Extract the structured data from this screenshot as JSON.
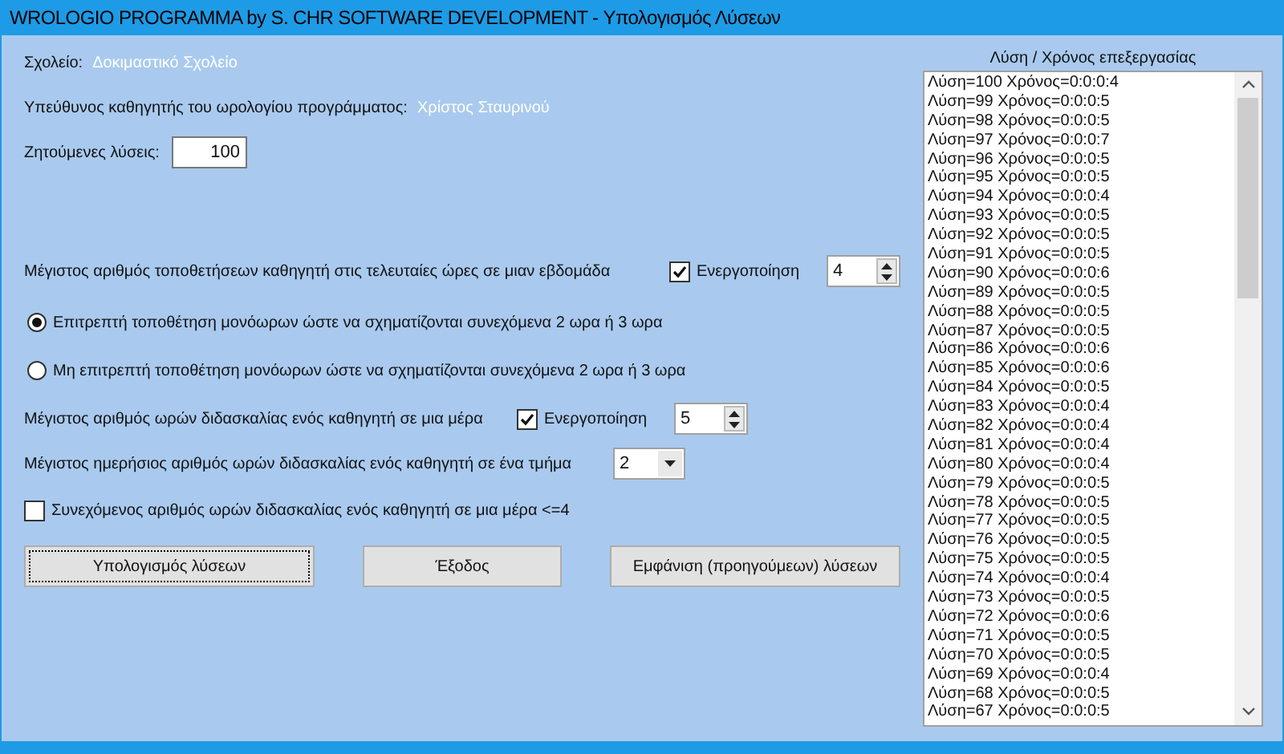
{
  "window": {
    "title": "WROLOGIO PROGRAMMA by S. CHR SOFTWARE DEVELOPMENT - Υπολογισμός Λύσεων"
  },
  "info": [
    {
      "label": "Σχολείο:",
      "value": "Δοκιμαστικό Σχολείο"
    },
    {
      "label": "Υπεύθυνος καθηγητής του ωρολογίου προγράμματος:",
      "value": "Χρίστος Σταυρινού"
    }
  ],
  "requested": {
    "label": "Ζητούμενες λύσεις:",
    "value": "100"
  },
  "options": [
    {
      "kind": "limit",
      "label": "Μέγιστος αριθμός τοποθετήσεων καθηγητή στις τελευταίες ώρες σε μιαν εβδομάδα",
      "check_label": "Ενεργοποίηση",
      "checked": true,
      "value": "4"
    },
    {
      "kind": "radio",
      "label": "Επιτρεπτή τοποθέτηση μονόωρων ώστε να σχηματίζονται συνεχόμενα 2 ωρα ή 3 ωρα",
      "selected": true
    },
    {
      "kind": "radio",
      "label": "Μη επιτρεπτή τοποθέτηση μονόωρων ώστε να σχηματίζονται συνεχόμενα 2 ωρα ή 3 ωρα",
      "selected": false
    },
    {
      "kind": "limit",
      "label": "Μέγιστος αριθμός ωρών διδασκαλίας ενός καθηγητή σε μια μέρα",
      "check_label": "Ενεργοποίηση",
      "checked": true,
      "value": "5"
    },
    {
      "kind": "combo",
      "label": "Μέγιστος ημερήσιος αριθμός ωρών διδασκαλίας ενός καθηγητή σε ένα τμήμα",
      "value": "2"
    },
    {
      "kind": "check",
      "label": "Συνεχόμενος αριθμός ωρών διδασκαλίας ενός καθηγητή σε μια μέρα <=4",
      "checked": false
    }
  ],
  "buttons": [
    {
      "label": "Υπολογισμός λύσεων",
      "focused": true
    },
    {
      "label": "Έξοδος",
      "focused": false
    },
    {
      "label": "Εμφάνιση (προηγούμεων) λύσεων",
      "focused": false
    }
  ],
  "results": {
    "heading": "Λύση / Χρόνος επεξεργασίας",
    "rows": [
      "Λύση=100 Χρόνος=0:0:0:4",
      "Λύση=99 Χρόνος=0:0:0:5",
      "Λύση=98 Χρόνος=0:0:0:5",
      "Λύση=97 Χρόνος=0:0:0:7",
      "Λύση=96 Χρόνος=0:0:0:5",
      "Λύση=95 Χρόνος=0:0:0:5",
      "Λύση=94 Χρόνος=0:0:0:4",
      "Λύση=93 Χρόνος=0:0:0:5",
      "Λύση=92 Χρόνος=0:0:0:5",
      "Λύση=91 Χρόνος=0:0:0:5",
      "Λύση=90 Χρόνος=0:0:0:6",
      "Λύση=89 Χρόνος=0:0:0:5",
      "Λύση=88 Χρόνος=0:0:0:5",
      "Λύση=87 Χρόνος=0:0:0:5",
      "Λύση=86 Χρόνος=0:0:0:6",
      "Λύση=85 Χρόνος=0:0:0:6",
      "Λύση=84 Χρόνος=0:0:0:5",
      "Λύση=83 Χρόνος=0:0:0:4",
      "Λύση=82 Χρόνος=0:0:0:4",
      "Λύση=81 Χρόνος=0:0:0:4",
      "Λύση=80 Χρόνος=0:0:0:4",
      "Λύση=79 Χρόνος=0:0:0:5",
      "Λύση=78 Χρόνος=0:0:0:5",
      "Λύση=77 Χρόνος=0:0:0:5",
      "Λύση=76 Χρόνος=0:0:0:5",
      "Λύση=75 Χρόνος=0:0:0:5",
      "Λύση=74 Χρόνος=0:0:0:4",
      "Λύση=73 Χρόνος=0:0:0:5",
      "Λύση=72 Χρόνος=0:0:0:6",
      "Λύση=71 Χρόνος=0:0:0:5",
      "Λύση=70 Χρόνος=0:0:0:5",
      "Λύση=69 Χρόνος=0:0:0:4",
      "Λύση=68 Χρόνος=0:0:0:5",
      "Λύση=67 Χρόνος=0:0:0:5"
    ]
  }
}
